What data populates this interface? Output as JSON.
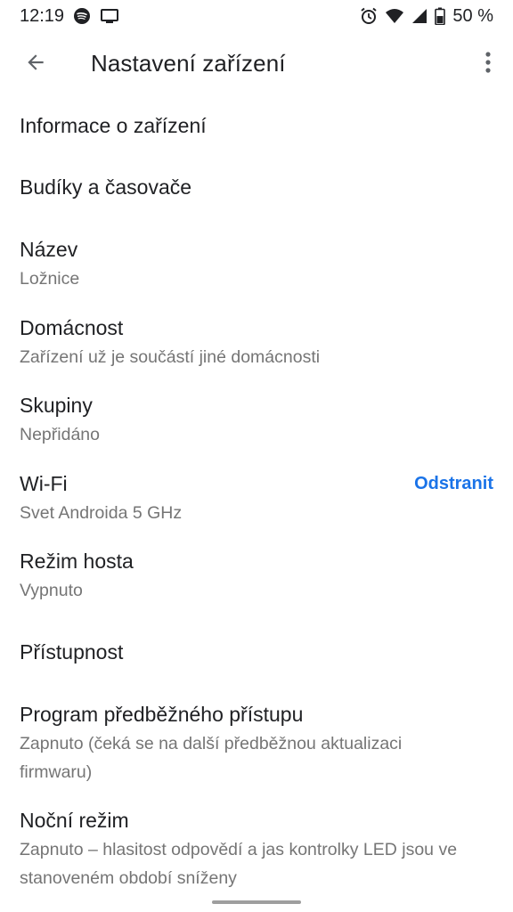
{
  "status_bar": {
    "time": "12:19",
    "battery": "50 %",
    "icons": [
      "spotify-icon",
      "cast-icon",
      "alarm-icon",
      "wifi-icon",
      "signal-icon",
      "battery-icon"
    ]
  },
  "app_bar": {
    "title": "Nastavení zařízení",
    "back_icon": "arrow-back-icon",
    "more_icon": "more-vert-icon"
  },
  "settings": {
    "device_info": {
      "title": "Informace o zařízení"
    },
    "alarms": {
      "title": "Budíky a časovače"
    },
    "name": {
      "title": "Název",
      "subtitle": "Ložnice"
    },
    "household": {
      "title": "Domácnost",
      "subtitle": "Zařízení už je součástí jiné domácnosti"
    },
    "groups": {
      "title": "Skupiny",
      "subtitle": "Nepřidáno"
    },
    "wifi": {
      "title": "Wi-Fi",
      "subtitle": "Svet Androida 5 GHz",
      "action": "Odstranit"
    },
    "guest_mode": {
      "title": "Režim hosta",
      "subtitle": "Vypnuto"
    },
    "accessibility": {
      "title": "Přístupnost"
    },
    "preview_program": {
      "title": "Program předběžného přístupu",
      "subtitle": "Zapnuto (čeká se na další předběžnou aktualizaci firmwaru)"
    },
    "night_mode": {
      "title": "Noční režim",
      "subtitle": "Zapnuto – hlasitost odpovědí a jas kontrolky LED jsou ve stanoveném období sníženy"
    }
  },
  "colors": {
    "accent": "#1a73e8",
    "text_primary": "#202124",
    "text_secondary": "#757575",
    "background": "#ffffff"
  }
}
